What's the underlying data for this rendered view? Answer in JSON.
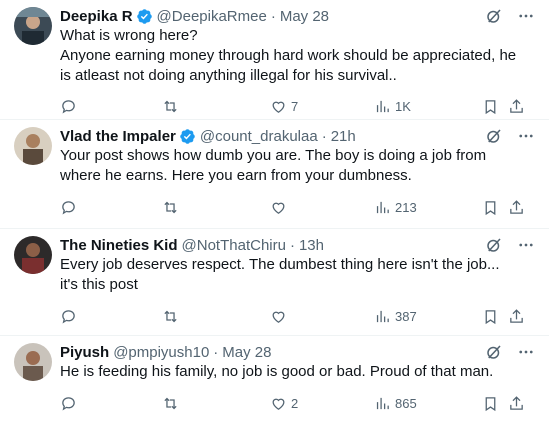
{
  "tweets": [
    {
      "name": "Deepika R",
      "verified": true,
      "handle": "@DeepikaRmee",
      "time": "May 28",
      "lines": [
        "What is wrong here?",
        "Anyone earning money through hard work should be appreciated, he is atleast not doing anything illegal for his survival.."
      ],
      "likes": "7",
      "views": "1K"
    },
    {
      "name": "Vlad the Impaler",
      "verified": true,
      "handle": "@count_drakulaa",
      "time": "21h",
      "lines": [
        "Your post shows how dumb you are. The boy is doing a job from where he earns. Here you earn from your dumbness."
      ],
      "likes": "",
      "views": "213"
    },
    {
      "name": "The Nineties Kid",
      "verified": false,
      "handle": "@NotThatChiru",
      "time": "13h",
      "lines": [
        "Every job deserves respect. The dumbest thing here isn't the job... it's this post"
      ],
      "likes": "",
      "views": "387"
    },
    {
      "name": "Piyush",
      "verified": false,
      "handle": "@pmpiyush10",
      "time": "May 28",
      "lines": [
        "He is feeding his family, no job is good or bad. Proud of that man."
      ],
      "likes": "2",
      "views": "865"
    }
  ],
  "separator": "·",
  "colors": {
    "verified": "#1d9bf0",
    "muted": "#536471",
    "text": "#0f1419"
  }
}
